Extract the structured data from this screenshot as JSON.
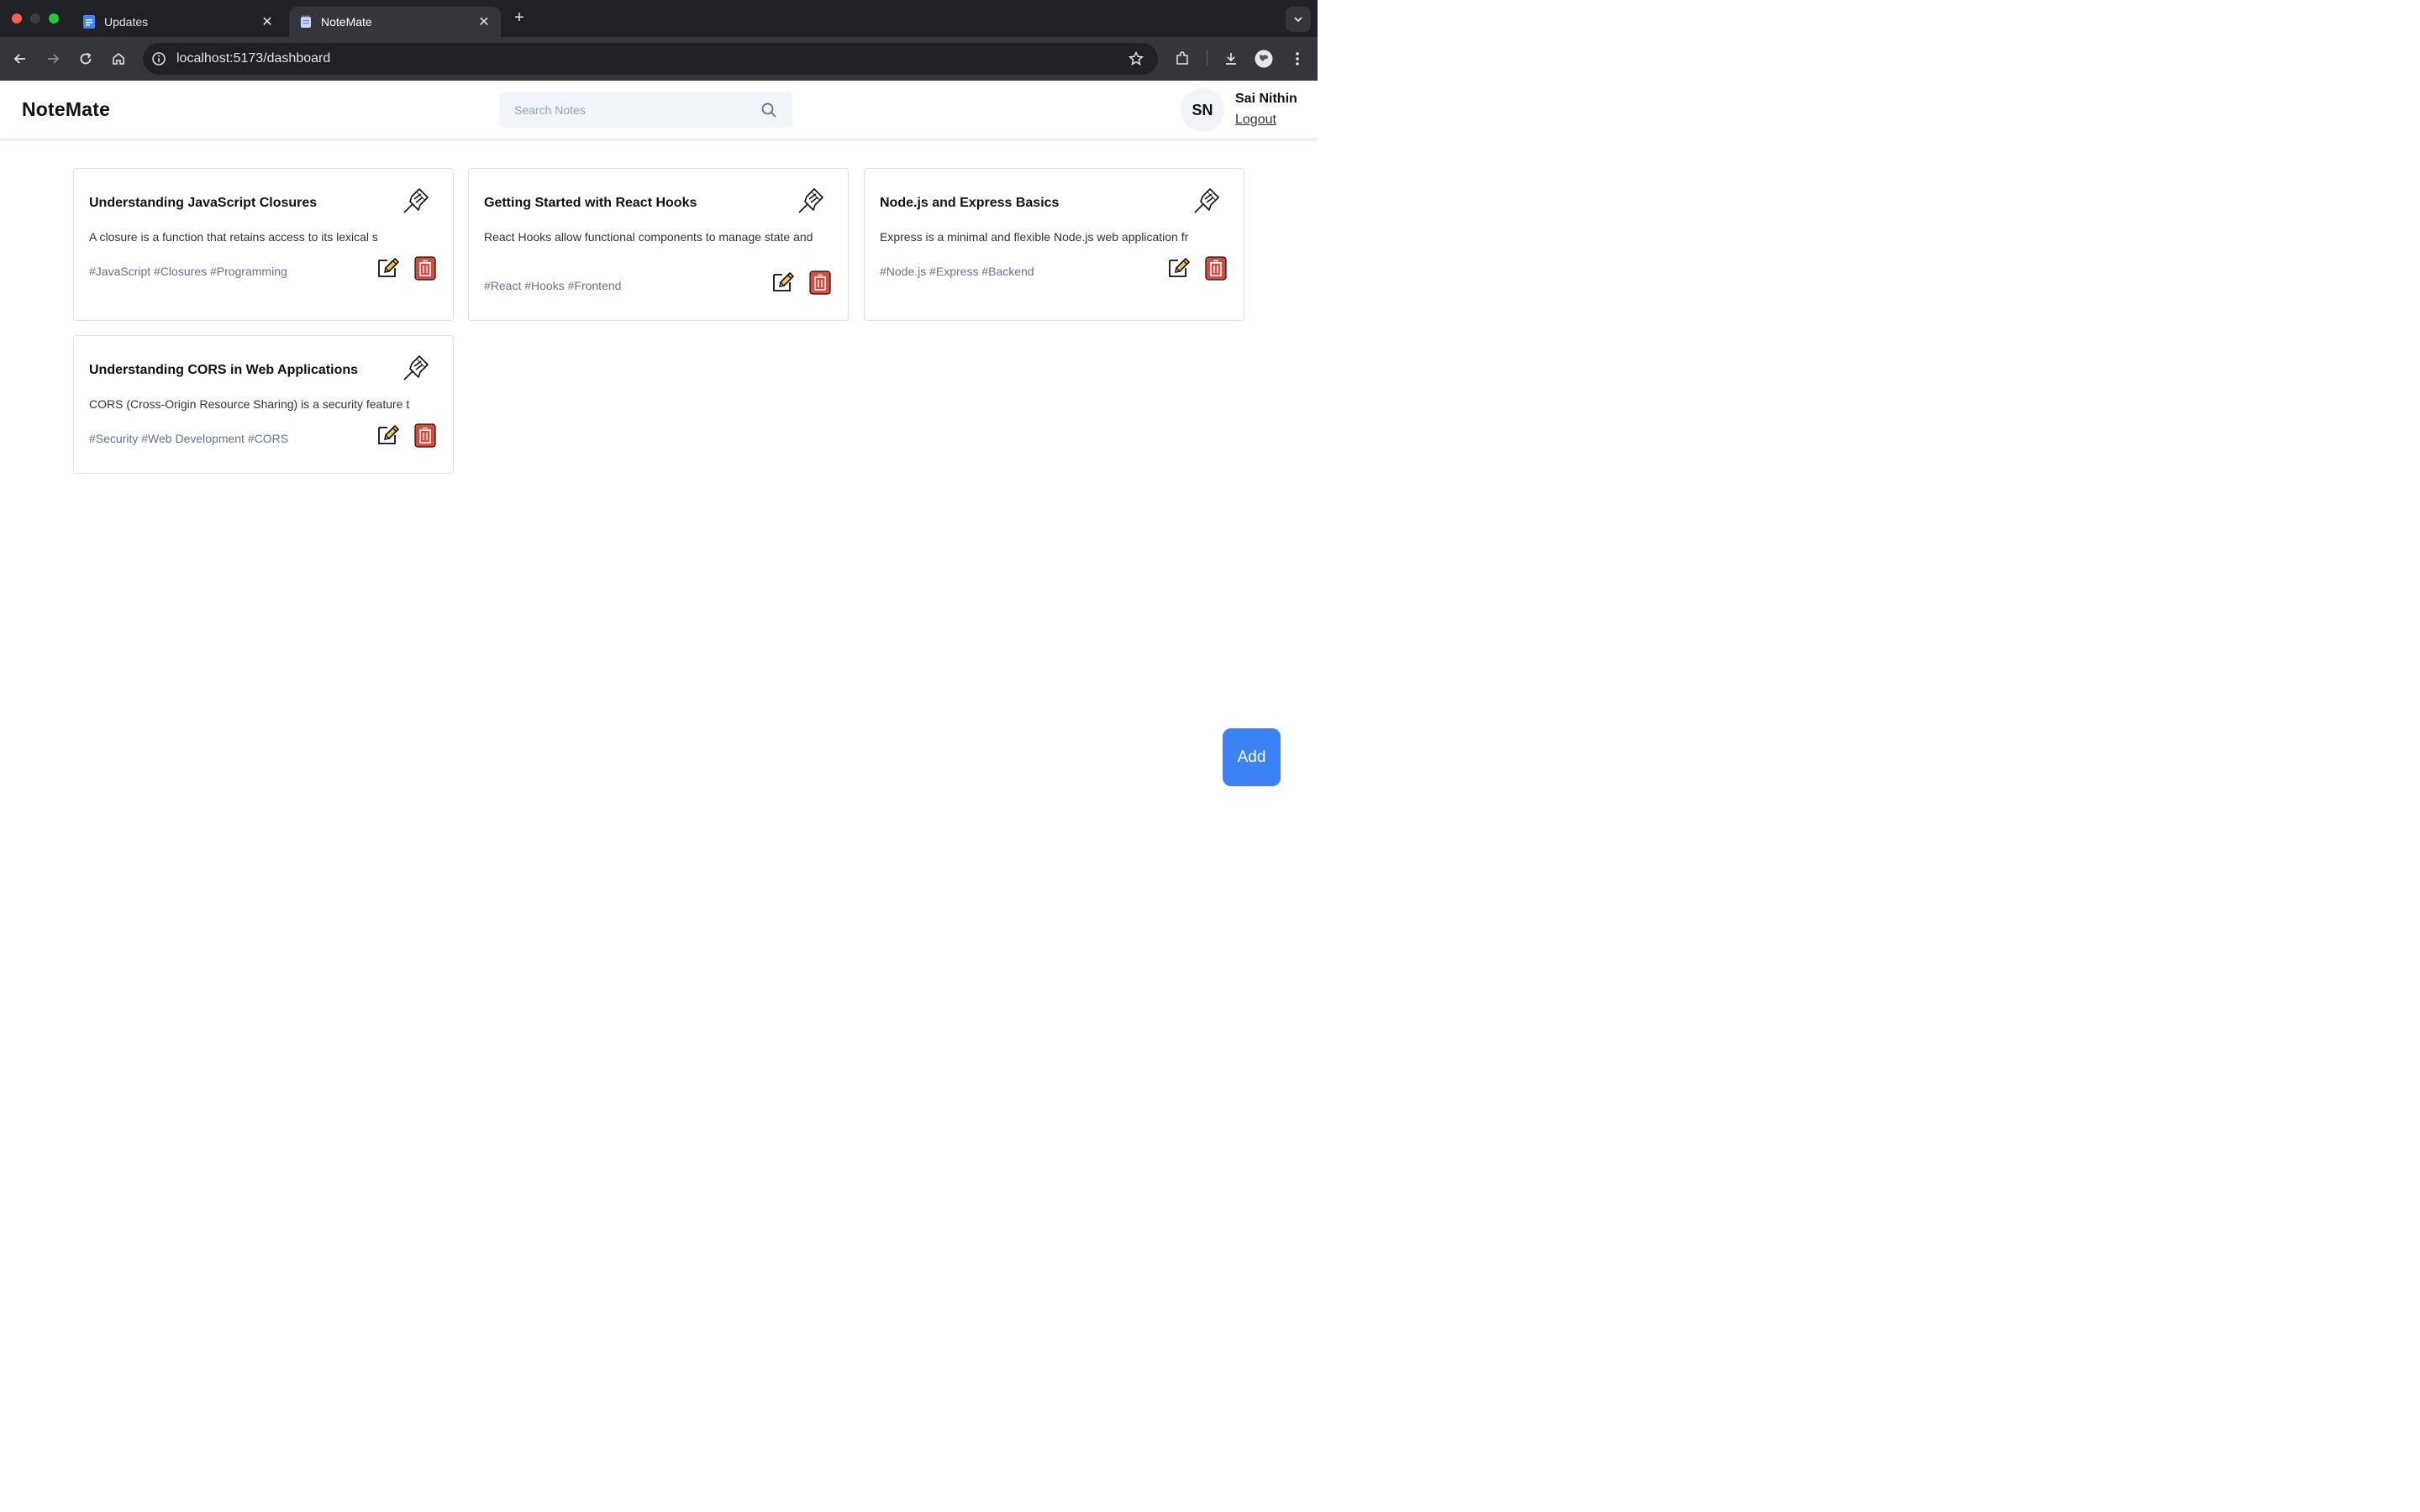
{
  "browser": {
    "tabs": [
      {
        "title": "Updates"
      },
      {
        "title": "NoteMate"
      }
    ],
    "url": "localhost:5173/dashboard"
  },
  "app": {
    "logo": "NoteMate",
    "search_placeholder": "Search Notes",
    "user": {
      "initials": "SN",
      "name": "Sai Nithin",
      "logout": "Logout"
    },
    "add_label": "Add"
  },
  "notes": [
    {
      "title": "Understanding JavaScript Closures",
      "content": "A closure is a function that retains access to its lexical s",
      "tags": "#JavaScript #Closures #Programming"
    },
    {
      "title": "Getting Started with React Hooks",
      "content": "React Hooks allow functional components to manage state and",
      "tags": "#React #Hooks #Frontend"
    },
    {
      "title": "Node.js and Express Basics",
      "content": "Express is a minimal and flexible Node.js web application fr",
      "tags": "#Node.js #Express #Backend"
    },
    {
      "title": "Understanding CORS in Web Applications",
      "content": "CORS (Cross-Origin Resource Sharing) is a security feature t",
      "tags": "#Security #Web Development #CORS"
    }
  ]
}
